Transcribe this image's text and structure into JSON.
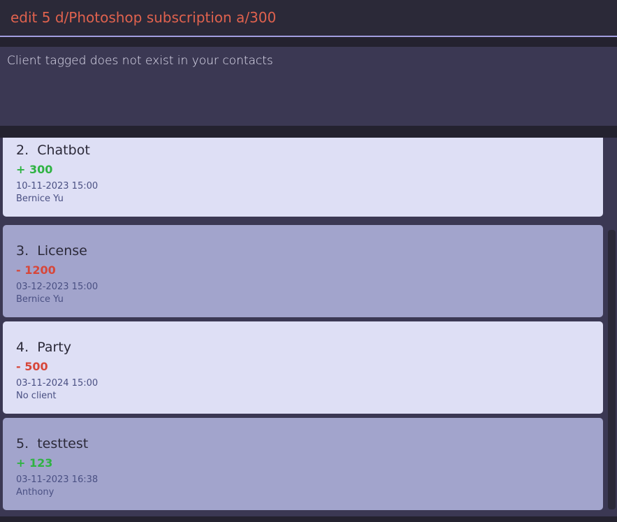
{
  "command": {
    "value": "edit 5 d/Photoshop subscription a/300"
  },
  "result": {
    "message": "Client tagged does not exist in your contacts"
  },
  "transactions": [
    {
      "index": "2.",
      "title": "Chatbot",
      "amount": "+ 300",
      "amount_type": "positive",
      "datetime": "10-11-2023 15:00",
      "client": "Bernice Yu"
    },
    {
      "index": "3.",
      "title": "License",
      "amount": "- 1200",
      "amount_type": "negative",
      "datetime": "03-12-2023 15:00",
      "client": "Bernice Yu"
    },
    {
      "index": "4.",
      "title": "Party",
      "amount": "- 500",
      "amount_type": "negative",
      "datetime": "03-11-2024 15:00",
      "client": "No client"
    },
    {
      "index": "5.",
      "title": "testtest",
      "amount": "+ 123",
      "amount_type": "positive",
      "datetime": "03-11-2023 16:38",
      "client": "Anthony"
    }
  ],
  "colors": {
    "positive": "#2fb343",
    "negative": "#d7473a",
    "command_text": "#e0624e",
    "accent_border": "#a39ee0"
  }
}
